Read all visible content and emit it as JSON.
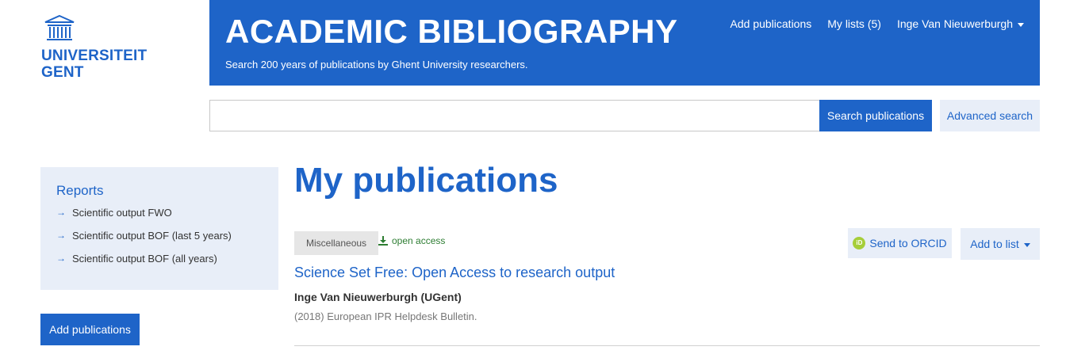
{
  "logo": {
    "line1": "UNIVERSITEIT",
    "line2": "GENT",
    "icon": "university-building-icon"
  },
  "header": {
    "title": "ACADEMIC BIBLIOGRAPHY",
    "subtitle": "Search 200 years of publications by Ghent University researchers.",
    "nav": {
      "add_publications": "Add publications",
      "my_lists": "My lists (5)",
      "user": "Inge Van Nieuwerburgh"
    },
    "brand_color": "#1e64c8"
  },
  "search": {
    "value": "",
    "placeholder": "",
    "button_label": "Search publications",
    "advanced_label": "Advanced search"
  },
  "sidebar": {
    "reports_title": "Reports",
    "items": [
      {
        "label": "Scientific output FWO"
      },
      {
        "label": "Scientific output BOF (last 5 years)"
      },
      {
        "label": "Scientific output BOF (all years)"
      }
    ],
    "add_button": "Add publications"
  },
  "main": {
    "title": "My publications",
    "publication": {
      "type": "Miscellaneous",
      "access": "open access",
      "title": "Science Set Free: Open Access to research output",
      "author": "Inge Van Nieuwerburgh (UGent)",
      "source": "(2018) European IPR Helpdesk Bulletin.",
      "orcid_label": "Send to ORCID",
      "add_to_list_label": "Add to list"
    }
  }
}
